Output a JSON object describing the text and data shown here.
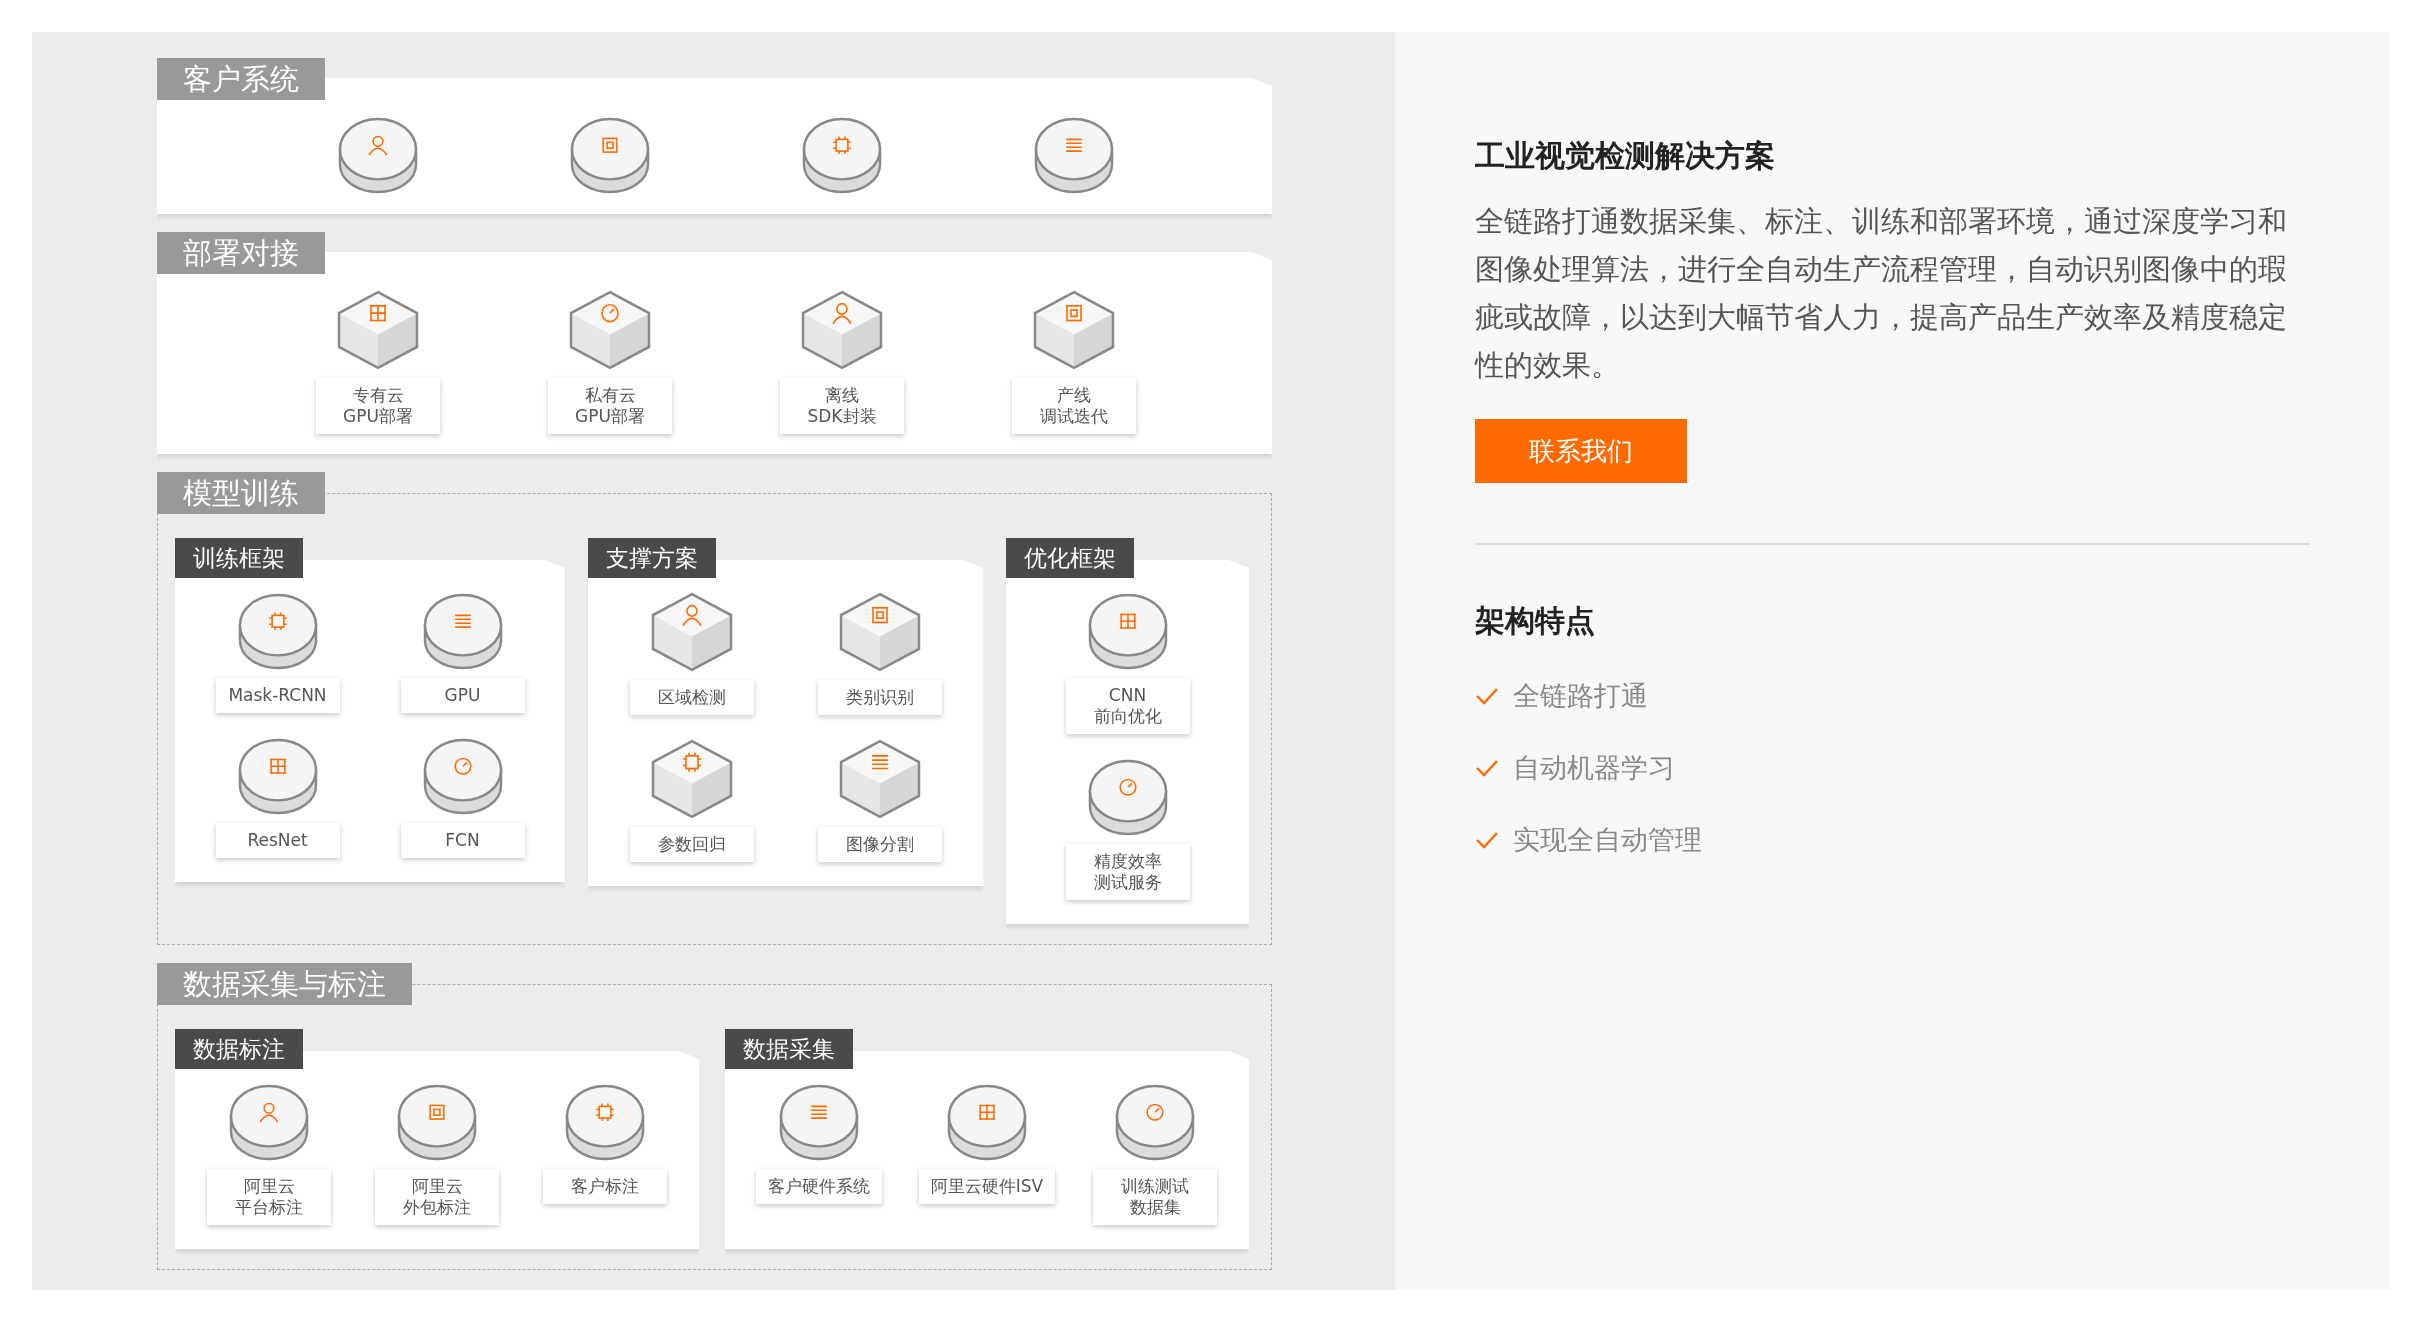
{
  "sections": [
    {
      "title": "客户系统",
      "kind": "row",
      "items": [
        {
          "kind": "disk"
        },
        {
          "kind": "disk"
        },
        {
          "kind": "disk"
        },
        {
          "kind": "disk"
        }
      ]
    },
    {
      "title": "部署对接",
      "kind": "row",
      "items": [
        {
          "kind": "cube",
          "label": [
            "专有云",
            "GPU部署"
          ]
        },
        {
          "kind": "cube",
          "label": [
            "私有云",
            "GPU部署"
          ]
        },
        {
          "kind": "cube",
          "label": [
            "离线",
            "SDK封装"
          ]
        },
        {
          "kind": "cube",
          "label": [
            "产线",
            "调试迭代"
          ]
        }
      ]
    },
    {
      "title": "模型训练",
      "kind": "groups",
      "groups": [
        {
          "title": "训练框架",
          "items": [
            {
              "kind": "disk",
              "label": [
                "Mask-RCNN"
              ]
            },
            {
              "kind": "disk",
              "label": [
                "GPU"
              ]
            },
            {
              "kind": "disk",
              "label": [
                "ResNet"
              ]
            },
            {
              "kind": "disk",
              "label": [
                "FCN"
              ]
            }
          ]
        },
        {
          "title": "支撑方案",
          "items": [
            {
              "kind": "cube",
              "label": [
                "区域检测"
              ]
            },
            {
              "kind": "cube",
              "label": [
                "类别识别"
              ]
            },
            {
              "kind": "cube",
              "label": [
                "参数回归"
              ]
            },
            {
              "kind": "cube",
              "label": [
                "图像分割"
              ]
            }
          ]
        },
        {
          "title": "优化框架",
          "items": [
            {
              "kind": "disk",
              "label": [
                "CNN",
                "前向优化"
              ]
            },
            {
              "kind": "disk",
              "label": [
                "精度效率",
                "测试服务"
              ]
            }
          ]
        }
      ]
    },
    {
      "title": "数据采集与标注",
      "kind": "groups",
      "groups": [
        {
          "title": "数据标注",
          "items": [
            {
              "kind": "disk",
              "label": [
                "阿里云",
                "平台标注"
              ]
            },
            {
              "kind": "disk",
              "label": [
                "阿里云",
                "外包标注"
              ]
            },
            {
              "kind": "disk",
              "label": [
                "客户标注"
              ]
            }
          ]
        },
        {
          "title": "数据采集",
          "items": [
            {
              "kind": "disk",
              "label": [
                "客户硬件系统"
              ]
            },
            {
              "kind": "disk",
              "label": [
                "阿里云硬件ISV"
              ]
            },
            {
              "kind": "disk",
              "label": [
                "训练测试",
                "数据集"
              ]
            }
          ]
        }
      ]
    }
  ],
  "panel": {
    "title": "工业视觉检测解决方案",
    "description": "全链路打通数据采集、标注、训练和部署环境，通过深度学习和图像处理算法，进行全自动生产流程管理，自动识别图像中的瑕疵或故障，以达到大幅节省人力，提高产品生产效率及精度稳定性的效果。",
    "button": "联系我们",
    "features_title": "架构特点",
    "features": [
      "全链路打通",
      "自动机器学习",
      "实现全自动管理"
    ]
  }
}
